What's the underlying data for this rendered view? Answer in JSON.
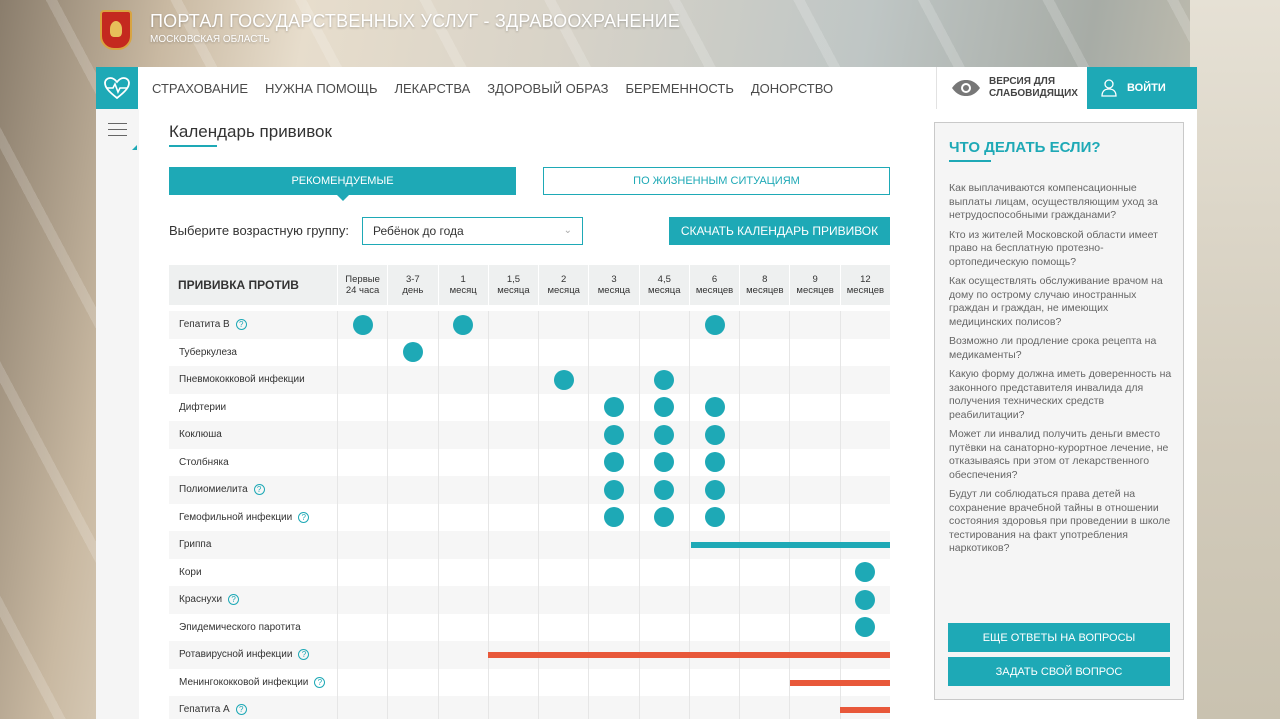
{
  "colors": {
    "accent": "#1ea9b6",
    "orange": "#e8583a"
  },
  "brand": {
    "title": "ПОРТАЛ ГОСУДАРСТВЕННЫХ УСЛУГ - ЗДРАВООХРАНЕНИЕ",
    "subtitle": "МОСКОВСКАЯ ОБЛАСТЬ"
  },
  "nav": {
    "items": [
      "СТРАХОВАНИЕ",
      "НУЖНА ПОМОЩЬ",
      "ЛЕКАРСТВА",
      "ЗДОРОВЫЙ ОБРАЗ",
      "БЕРЕМЕННОСТЬ",
      "ДОНОРСТВО"
    ],
    "vision_line1": "ВЕРСИЯ ДЛЯ",
    "vision_line2": "СЛАБОВИДЯЩИХ",
    "login": "ВОЙТИ"
  },
  "page": {
    "title": "Календарь прививок",
    "tab_recommended": "РЕКОМЕНДУЕМЫЕ",
    "tab_situations": "ПО ЖИЗНЕННЫМ СИТУАЦИЯМ",
    "age_label": "Выберите возрастную группу:",
    "age_value": "Ребёнок до года",
    "download": "СКАЧАТЬ КАЛЕНДАРЬ ПРИВИВОК"
  },
  "table": {
    "header": "ПРИВИВКА ПРОТИВ",
    "ages": [
      [
        "Первые",
        "24 часа"
      ],
      [
        "3-7",
        "день"
      ],
      [
        "1",
        "месяц"
      ],
      [
        "1,5",
        "месяца"
      ],
      [
        "2",
        "месяца"
      ],
      [
        "3",
        "месяца"
      ],
      [
        "4,5",
        "месяца"
      ],
      [
        "6",
        "месяцев"
      ],
      [
        "8",
        "месяцев"
      ],
      [
        "9",
        "месяцев"
      ],
      [
        "12",
        "месяцев"
      ]
    ],
    "rows": [
      {
        "name": "Гепатита В",
        "help": true,
        "dots": [
          0,
          2,
          7
        ]
      },
      {
        "name": "Туберкулеза",
        "help": false,
        "dots": [
          1
        ]
      },
      {
        "name": "Пневмококковой инфекции",
        "help": false,
        "dots": [
          4,
          6
        ]
      },
      {
        "name": "Дифтерии",
        "help": false,
        "dots": [
          5,
          6,
          7
        ]
      },
      {
        "name": "Коклюша",
        "help": false,
        "dots": [
          5,
          6,
          7
        ]
      },
      {
        "name": "Столбняка",
        "help": false,
        "dots": [
          5,
          6,
          7
        ]
      },
      {
        "name": "Полиомиелита",
        "help": true,
        "dots": [
          5,
          6,
          7
        ]
      },
      {
        "name": "Гемофильной инфекции",
        "help": true,
        "dots": [
          5,
          6,
          7
        ]
      },
      {
        "name": "Гриппа",
        "help": false,
        "dots": [],
        "bar": {
          "from": 7,
          "to": 10,
          "color": "teal"
        }
      },
      {
        "name": "Кори",
        "help": false,
        "dots": [
          10
        ]
      },
      {
        "name": "Краснухи",
        "help": true,
        "dots": [
          10
        ]
      },
      {
        "name": "Эпидемического паротита",
        "help": false,
        "dots": [
          10
        ]
      },
      {
        "name": "Ротавирусной инфекции",
        "help": true,
        "dots": [],
        "bar": {
          "from": 3,
          "to": 10,
          "color": "orange"
        }
      },
      {
        "name": "Менингококковой инфекции",
        "help": true,
        "dots": [],
        "bar": {
          "from": 9,
          "to": 10,
          "color": "orange"
        }
      },
      {
        "name": "Гепатита А",
        "help": true,
        "dots": [],
        "bar": {
          "from": 10,
          "to": 10,
          "color": "orange"
        }
      }
    ]
  },
  "sidebar": {
    "title": "ЧТО ДЕЛАТЬ ЕСЛИ?",
    "questions": [
      "Как выплачиваются компенсационные выплаты лицам, осуществляющим уход за нетрудоспособными гражданами?",
      "Кто из жителей Московской области имеет право на бесплатную протезно-ортопедическую помощь?",
      "Как осуществлять обслуживание врачом на дому по острому случаю иностранных граждан и граждан, не имеющих медицинских полисов?",
      "Возможно ли продление срока рецепта на медикаменты?",
      "Какую форму должна иметь доверенность на законного представителя инвалида для получения технических средств реабилитации?",
      "Может ли инвалид получить деньги вместо путёвки на санаторно-курортное лечение, не отказываясь при этом от лекарственного обеспечения?",
      "Будут ли соблюдаться права детей на сохранение врачебной тайны в отношении состояния здоровья при проведении в школе тестирования на факт употребления наркотиков?"
    ],
    "more_answers": "ЕЩЕ ОТВЕТЫ НА ВОПРОСЫ",
    "ask": "ЗАДАТЬ СВОЙ ВОПРОС"
  }
}
